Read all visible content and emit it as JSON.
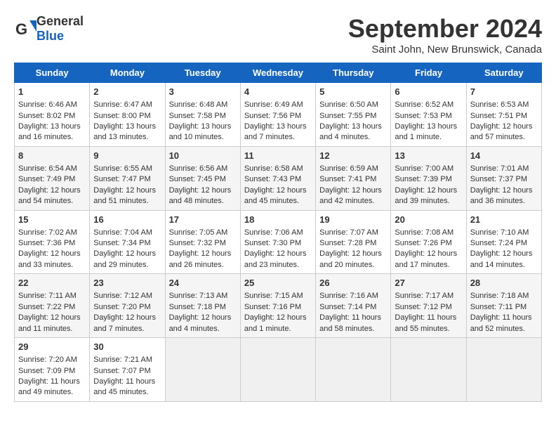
{
  "header": {
    "logo_general": "General",
    "logo_blue": "Blue",
    "title": "September 2024",
    "subtitle": "Saint John, New Brunswick, Canada"
  },
  "days_of_week": [
    "Sunday",
    "Monday",
    "Tuesday",
    "Wednesday",
    "Thursday",
    "Friday",
    "Saturday"
  ],
  "weeks": [
    [
      {
        "day": "1",
        "lines": [
          "Sunrise: 6:46 AM",
          "Sunset: 8:02 PM",
          "Daylight: 13 hours",
          "and 16 minutes."
        ]
      },
      {
        "day": "2",
        "lines": [
          "Sunrise: 6:47 AM",
          "Sunset: 8:00 PM",
          "Daylight: 13 hours",
          "and 13 minutes."
        ]
      },
      {
        "day": "3",
        "lines": [
          "Sunrise: 6:48 AM",
          "Sunset: 7:58 PM",
          "Daylight: 13 hours",
          "and 10 minutes."
        ]
      },
      {
        "day": "4",
        "lines": [
          "Sunrise: 6:49 AM",
          "Sunset: 7:56 PM",
          "Daylight: 13 hours",
          "and 7 minutes."
        ]
      },
      {
        "day": "5",
        "lines": [
          "Sunrise: 6:50 AM",
          "Sunset: 7:55 PM",
          "Daylight: 13 hours",
          "and 4 minutes."
        ]
      },
      {
        "day": "6",
        "lines": [
          "Sunrise: 6:52 AM",
          "Sunset: 7:53 PM",
          "Daylight: 13 hours",
          "and 1 minute."
        ]
      },
      {
        "day": "7",
        "lines": [
          "Sunrise: 6:53 AM",
          "Sunset: 7:51 PM",
          "Daylight: 12 hours",
          "and 57 minutes."
        ]
      }
    ],
    [
      {
        "day": "8",
        "lines": [
          "Sunrise: 6:54 AM",
          "Sunset: 7:49 PM",
          "Daylight: 12 hours",
          "and 54 minutes."
        ]
      },
      {
        "day": "9",
        "lines": [
          "Sunrise: 6:55 AM",
          "Sunset: 7:47 PM",
          "Daylight: 12 hours",
          "and 51 minutes."
        ]
      },
      {
        "day": "10",
        "lines": [
          "Sunrise: 6:56 AM",
          "Sunset: 7:45 PM",
          "Daylight: 12 hours",
          "and 48 minutes."
        ]
      },
      {
        "day": "11",
        "lines": [
          "Sunrise: 6:58 AM",
          "Sunset: 7:43 PM",
          "Daylight: 12 hours",
          "and 45 minutes."
        ]
      },
      {
        "day": "12",
        "lines": [
          "Sunrise: 6:59 AM",
          "Sunset: 7:41 PM",
          "Daylight: 12 hours",
          "and 42 minutes."
        ]
      },
      {
        "day": "13",
        "lines": [
          "Sunrise: 7:00 AM",
          "Sunset: 7:39 PM",
          "Daylight: 12 hours",
          "and 39 minutes."
        ]
      },
      {
        "day": "14",
        "lines": [
          "Sunrise: 7:01 AM",
          "Sunset: 7:37 PM",
          "Daylight: 12 hours",
          "and 36 minutes."
        ]
      }
    ],
    [
      {
        "day": "15",
        "lines": [
          "Sunrise: 7:02 AM",
          "Sunset: 7:36 PM",
          "Daylight: 12 hours",
          "and 33 minutes."
        ]
      },
      {
        "day": "16",
        "lines": [
          "Sunrise: 7:04 AM",
          "Sunset: 7:34 PM",
          "Daylight: 12 hours",
          "and 29 minutes."
        ]
      },
      {
        "day": "17",
        "lines": [
          "Sunrise: 7:05 AM",
          "Sunset: 7:32 PM",
          "Daylight: 12 hours",
          "and 26 minutes."
        ]
      },
      {
        "day": "18",
        "lines": [
          "Sunrise: 7:06 AM",
          "Sunset: 7:30 PM",
          "Daylight: 12 hours",
          "and 23 minutes."
        ]
      },
      {
        "day": "19",
        "lines": [
          "Sunrise: 7:07 AM",
          "Sunset: 7:28 PM",
          "Daylight: 12 hours",
          "and 20 minutes."
        ]
      },
      {
        "day": "20",
        "lines": [
          "Sunrise: 7:08 AM",
          "Sunset: 7:26 PM",
          "Daylight: 12 hours",
          "and 17 minutes."
        ]
      },
      {
        "day": "21",
        "lines": [
          "Sunrise: 7:10 AM",
          "Sunset: 7:24 PM",
          "Daylight: 12 hours",
          "and 14 minutes."
        ]
      }
    ],
    [
      {
        "day": "22",
        "lines": [
          "Sunrise: 7:11 AM",
          "Sunset: 7:22 PM",
          "Daylight: 12 hours",
          "and 11 minutes."
        ]
      },
      {
        "day": "23",
        "lines": [
          "Sunrise: 7:12 AM",
          "Sunset: 7:20 PM",
          "Daylight: 12 hours",
          "and 7 minutes."
        ]
      },
      {
        "day": "24",
        "lines": [
          "Sunrise: 7:13 AM",
          "Sunset: 7:18 PM",
          "Daylight: 12 hours",
          "and 4 minutes."
        ]
      },
      {
        "day": "25",
        "lines": [
          "Sunrise: 7:15 AM",
          "Sunset: 7:16 PM",
          "Daylight: 12 hours",
          "and 1 minute."
        ]
      },
      {
        "day": "26",
        "lines": [
          "Sunrise: 7:16 AM",
          "Sunset: 7:14 PM",
          "Daylight: 11 hours",
          "and 58 minutes."
        ]
      },
      {
        "day": "27",
        "lines": [
          "Sunrise: 7:17 AM",
          "Sunset: 7:12 PM",
          "Daylight: 11 hours",
          "and 55 minutes."
        ]
      },
      {
        "day": "28",
        "lines": [
          "Sunrise: 7:18 AM",
          "Sunset: 7:11 PM",
          "Daylight: 11 hours",
          "and 52 minutes."
        ]
      }
    ],
    [
      {
        "day": "29",
        "lines": [
          "Sunrise: 7:20 AM",
          "Sunset: 7:09 PM",
          "Daylight: 11 hours",
          "and 49 minutes."
        ]
      },
      {
        "day": "30",
        "lines": [
          "Sunrise: 7:21 AM",
          "Sunset: 7:07 PM",
          "Daylight: 11 hours",
          "and 45 minutes."
        ]
      },
      {
        "day": "",
        "lines": []
      },
      {
        "day": "",
        "lines": []
      },
      {
        "day": "",
        "lines": []
      },
      {
        "day": "",
        "lines": []
      },
      {
        "day": "",
        "lines": []
      }
    ]
  ]
}
